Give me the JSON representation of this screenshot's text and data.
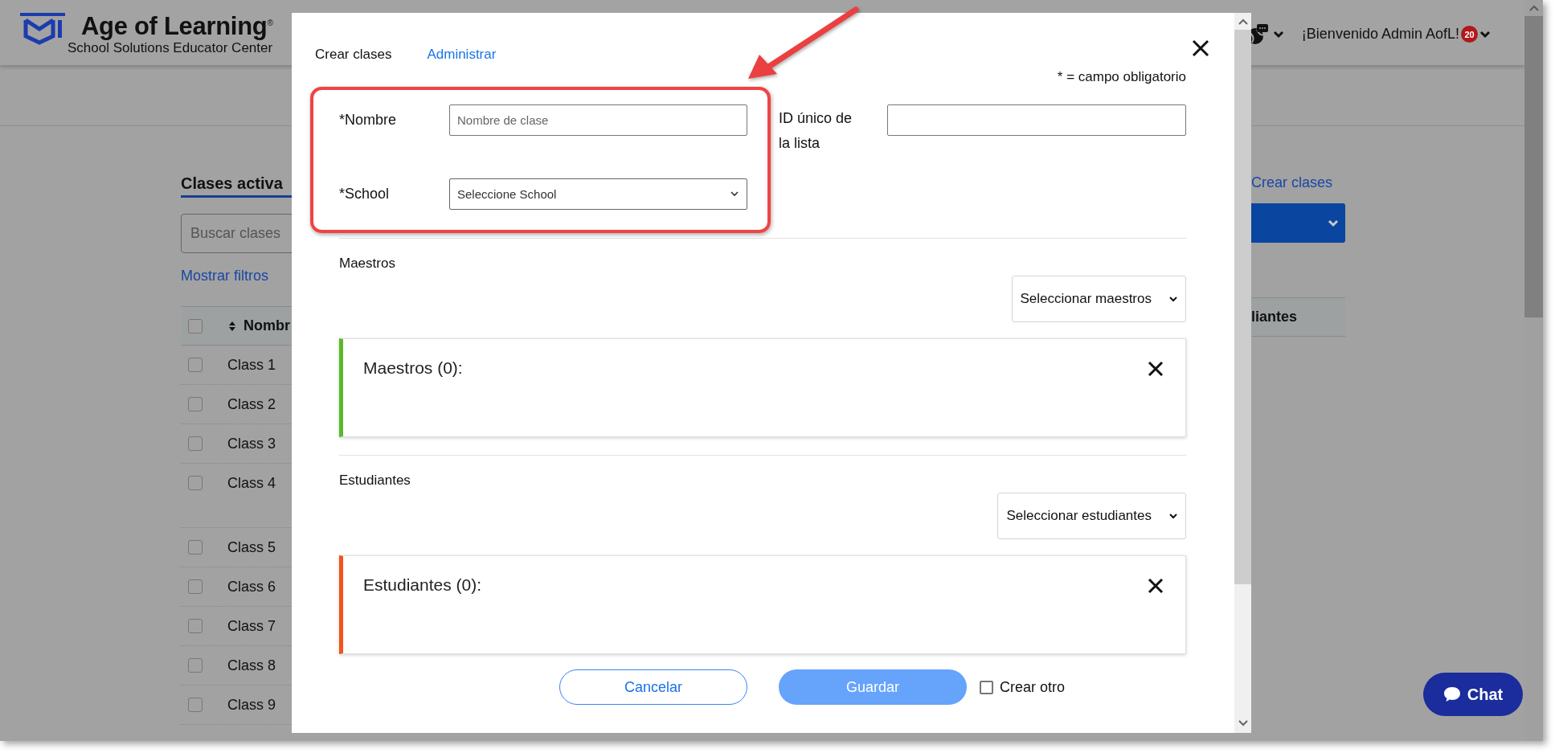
{
  "header": {
    "logo_title": "Age of Learning$^{®}$",
    "logo_subtitle": "School Solutions Educator Center",
    "welcome": "¡Bienvenido Admin AofL!",
    "notification_count": "20"
  },
  "background_page": {
    "heading": "Clases activa",
    "search_placeholder": "Buscar clases",
    "filters_link": "Mostrar filtros",
    "create_link": "Crear clases",
    "select_all_checked": false,
    "columns": [
      {
        "label": "Nombr"
      },
      {
        "label": "liantes"
      }
    ],
    "rows": [
      {
        "name": "Class 1",
        "checked": false
      },
      {
        "name": "Class 2",
        "checked": false
      },
      {
        "name": "Class 3",
        "checked": false
      },
      {
        "name": "Class 4",
        "checked": false
      },
      {
        "name": "Class 5",
        "checked": false
      },
      {
        "name": "Class 6",
        "checked": false
      },
      {
        "name": "Class 7",
        "checked": false
      },
      {
        "name": "Class 8",
        "checked": false
      },
      {
        "name": "Class 9",
        "checked": false
      }
    ]
  },
  "modal": {
    "tabs": [
      {
        "label": "Crear clases",
        "selected": true
      },
      {
        "label": "Administrar",
        "selected": false
      }
    ],
    "required_note": "* = campo obligatorio",
    "fields": [
      {
        "kind": "text",
        "label": "*Nombre",
        "placeholder": "Nombre de clase",
        "highlighted": true
      },
      {
        "kind": "select",
        "label": "*School",
        "value": "Seleccione School",
        "highlighted": true
      },
      {
        "kind": "text",
        "label": "ID único de la lista",
        "highlighted": false
      }
    ],
    "sections": [
      {
        "title": "Maestros",
        "picker": "Seleccionar maestros",
        "list_title": "Maestros (0):",
        "color": "#5cb82a"
      },
      {
        "title": "Estudiantes",
        "picker": "Seleccionar estudiantes",
        "list_title": "Estudiantes (0):",
        "color": "#f2541b"
      }
    ],
    "buttons": [
      {
        "kind": "secondary",
        "label": "Cancelar"
      },
      {
        "kind": "primary",
        "label": "Guardar"
      }
    ],
    "create_another": {
      "label": "Crear otro",
      "checked": false
    }
  },
  "chat": {
    "label": "Chat"
  }
}
